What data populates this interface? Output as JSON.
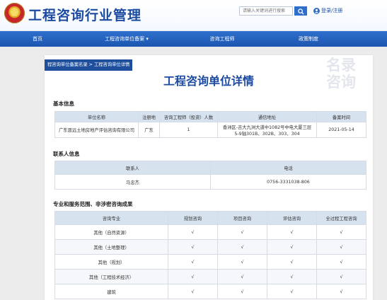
{
  "header": {
    "site_title": "工程咨询行业管理",
    "search_placeholder": "请输入关键词进行搜索",
    "login_label": "登录/注册"
  },
  "nav": {
    "items": [
      {
        "label": "首页"
      },
      {
        "label": "工程咨询单位备案"
      },
      {
        "label": "咨询工程师"
      },
      {
        "label": "政策制度"
      }
    ]
  },
  "breadcrumb": {
    "text": "程咨询单位备案名录 > 工程咨询单位详情"
  },
  "page": {
    "title": "工程咨询单位详情",
    "watermark_line1": "名录",
    "watermark_line2": "咨询"
  },
  "basic": {
    "section_title": "基本信息",
    "headers": [
      "单位名称",
      "注册地",
      "咨询工程师（投资）人数",
      "通信地址",
      "备案时间"
    ],
    "row": {
      "name": "广东恩远土地房地产评估咨询有限公司",
      "region": "广东",
      "engineer_count": "1",
      "address_line1": "香洲区-吉大九洲大道中1082号中电大厦三层",
      "address_line2": "5-9轴301B、302B、303、304",
      "record_date": "2021-05-14"
    }
  },
  "contact": {
    "section_title": "联系人信息",
    "headers": [
      "联系人",
      "电话"
    ],
    "row": {
      "name": "马忠杰",
      "phone": "0756-3331038-806"
    }
  },
  "services": {
    "section_title": "专业和服务范围、非涉密咨询成果",
    "headers": [
      "咨询专业",
      "规划咨询",
      "项目咨询",
      "评估咨询",
      "全过程工程咨询"
    ],
    "rows": [
      {
        "name": "其他（自然资源）",
        "cells": [
          "√",
          "√",
          "√",
          "√"
        ]
      },
      {
        "name": "其他（土地整理）",
        "cells": [
          "√",
          "√",
          "√",
          "√"
        ]
      },
      {
        "name": "其他（规划）",
        "cells": [
          "√",
          "√",
          "√",
          "√"
        ]
      },
      {
        "name": "其他（工程技术经济）",
        "cells": [
          "√",
          "√",
          "√",
          "√"
        ]
      },
      {
        "name": "建筑",
        "cells": [
          "√",
          "√",
          "√",
          "√"
        ]
      }
    ]
  },
  "colors": {
    "brand_blue": "#1b4aa0",
    "nav_blue": "#2462bf",
    "breadcrumb_blue": "#1d4f9c",
    "table_header": "#d7e2ef"
  }
}
